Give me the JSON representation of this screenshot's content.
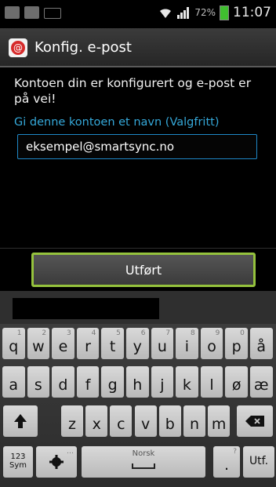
{
  "status": {
    "battery": "72%",
    "time": "11:07"
  },
  "header": {
    "title": "Konfig. e-post"
  },
  "content": {
    "message": "Kontoen din er konfigurert og e-post er på vei!",
    "prompt": "Gi denne kontoen et navn (Valgfritt)",
    "account_name": "eksempel@smartsync.no",
    "done_label": "Utført"
  },
  "keyboard": {
    "row1": [
      {
        "ch": "q",
        "sub": "1"
      },
      {
        "ch": "w",
        "sub": "2"
      },
      {
        "ch": "e",
        "sub": "3"
      },
      {
        "ch": "r",
        "sub": "4"
      },
      {
        "ch": "t",
        "sub": "5"
      },
      {
        "ch": "y",
        "sub": "6"
      },
      {
        "ch": "u",
        "sub": "7"
      },
      {
        "ch": "i",
        "sub": "8"
      },
      {
        "ch": "o",
        "sub": "9"
      },
      {
        "ch": "p",
        "sub": "0"
      },
      {
        "ch": "å",
        "sub": ""
      }
    ],
    "row2": [
      "a",
      "s",
      "d",
      "f",
      "g",
      "h",
      "j",
      "k",
      "l",
      "ø",
      "æ"
    ],
    "row3": [
      "z",
      "x",
      "c",
      "v",
      "b",
      "n",
      "m"
    ],
    "sym_label_top": "123",
    "sym_label_bottom": "Sym",
    "space_label": "Norsk",
    "period": ".",
    "period_sub": "?",
    "enter_label": "Utf."
  }
}
